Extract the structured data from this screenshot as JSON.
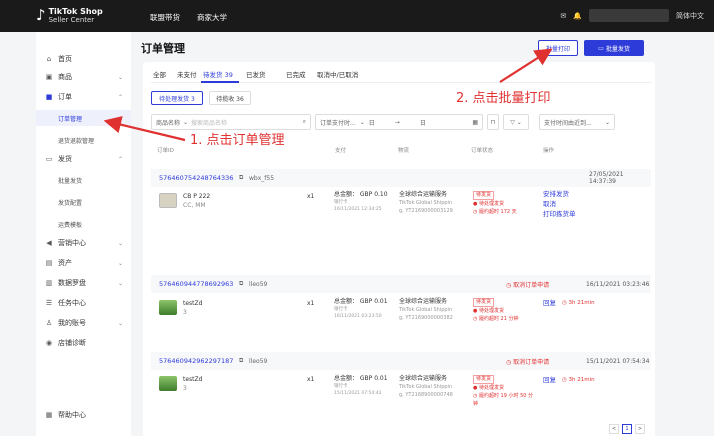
{
  "header": {
    "logo_title": "TikTok Shop",
    "logo_subtitle": "Seller Center",
    "nav": [
      "联盟带货",
      "商家大学"
    ],
    "language": "简体中文"
  },
  "sidebar": {
    "items": [
      {
        "label": "首页",
        "icon": "home-icon"
      },
      {
        "label": "商品",
        "icon": "product-icon",
        "chevron": "⌄"
      },
      {
        "label": "订单",
        "icon": "order-icon",
        "chevron": "⌃"
      },
      {
        "label": "发货",
        "icon": "shipping-icon",
        "chevron": "⌃"
      },
      {
        "label": "营销中心",
        "icon": "marketing-icon",
        "chevron": "⌄"
      },
      {
        "label": "资产",
        "icon": "asset-icon",
        "chevron": "⌄"
      },
      {
        "label": "数据罗盘",
        "icon": "data-icon",
        "chevron": "⌄"
      },
      {
        "label": "任务中心",
        "icon": "task-icon"
      },
      {
        "label": "我的账号",
        "icon": "account-icon",
        "chevron": "⌄"
      },
      {
        "label": "店铺诊断",
        "icon": "diagnosis-icon"
      },
      {
        "label": "帮助中心",
        "icon": "help-icon"
      }
    ],
    "order_sub": [
      "订单管理",
      "退货退款管理"
    ],
    "ship_sub": [
      "批量发货",
      "发货配置",
      "运费模板"
    ]
  },
  "page": {
    "title": "订单管理",
    "batch_print": "批量打印",
    "batch_ship": "批量发货"
  },
  "tabs": [
    "全部",
    "未支付",
    "待发货 39",
    "已发货",
    "已完成",
    "取消中/已取消"
  ],
  "sub_tabs": [
    "待处理发货 3",
    "待揽收 36"
  ],
  "filters": {
    "field": "商品名称",
    "placeholder": "搜索商品名称",
    "pay_time": "订单支付时...",
    "date_start": "日",
    "date_end": "日",
    "sort": "支付时间由近到..."
  },
  "columns": [
    "订单ID",
    "支付",
    "物流",
    "订单状态",
    "操作"
  ],
  "orders": [
    {
      "id": "576460754248764336",
      "buyer": "wbx_f55",
      "time": "27/05/2021 14:37:39",
      "product_name": "CB P 222",
      "product_spec": "CC, MM",
      "qty": "x1",
      "total": "总金额： GBP 0.10",
      "pay_method": "银行卡",
      "pay_time": "16/11/2021 12:34:25",
      "logistics": "全球综合运输服务",
      "carrier": "TikTok Global Shippin",
      "tracking": "g, YT2169000003129",
      "status_tag": "待发货",
      "status_line": "● 待处理发货",
      "deadline": "◷ 履约超时 172 天",
      "actions": [
        "安排发货",
        "取消",
        "打印拣货单"
      ]
    },
    {
      "id": "576460944778692963",
      "buyer": "lleo59",
      "time": "16/11/2021 03:23:46",
      "cancel_req": "◷ 取消订单申请",
      "product_name": "testZd",
      "product_spec": "3",
      "qty": "x1",
      "total": "总金额： GBP 0.01",
      "pay_method": "银行卡",
      "pay_time": "16/11/2021 03:23:50",
      "logistics": "全球综合运输服务",
      "carrier": "TikTok Global Shippin",
      "tracking": "g, YT2169000000382",
      "status_tag": "待发货",
      "status_line": "● 待处理发货",
      "deadline": "◷ 履约超时 21 分钟",
      "actions": [
        "回复"
      ],
      "reply_timer": "◷ 3h 21min"
    },
    {
      "id": "576460942962297187",
      "buyer": "lleo59",
      "time": "15/11/2021 07:54:34",
      "cancel_req": "◷ 取消订单申请",
      "product_name": "testZd",
      "product_spec": "3",
      "qty": "x1",
      "total": "总金额： GBP 0.01",
      "pay_method": "银行卡",
      "pay_time": "15/11/2021 07:54:42",
      "logistics": "全球综合运输服务",
      "carrier": "TikTok Global Shippin",
      "tracking": "g, YT2168900000748",
      "status_tag": "待发货",
      "status_line": "● 待处理发货",
      "deadline": "◷ 履约超时 19 小时 50 分钟",
      "actions": [
        "回复"
      ],
      "reply_timer": "◷ 3h 21min"
    }
  ],
  "pager": {
    "prev": "<",
    "current": "1",
    "next": ">"
  },
  "annotations": {
    "step1": "1. 点击订单管理",
    "step2": "2. 点击批量打印"
  },
  "colors": {
    "accent": "#2d3bd9",
    "annotation": "#e03131",
    "topbar": "#1a1a1a"
  }
}
